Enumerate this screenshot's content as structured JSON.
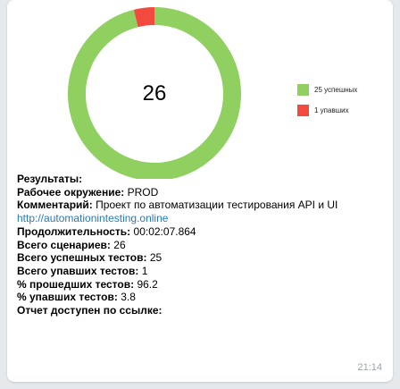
{
  "message": {
    "chart_data": {
      "type": "donut",
      "center_text": "26",
      "values": [
        25,
        1
      ],
      "labels": [
        "25 успешных",
        "1 упавших"
      ],
      "colors": [
        "#90d060",
        "#f24a3e"
      ]
    },
    "legend": [
      {
        "label": "25 успешных",
        "color": "#90d060"
      },
      {
        "label": "1 упавших",
        "color": "#f24a3e"
      }
    ],
    "report": {
      "results_label": "Результаты:",
      "env_label": "Рабочее окружение:",
      "env_value": "PROD",
      "comment_label": "Комментарий:",
      "comment_value": "Проект по автоматизации тестирования API и UI",
      "link": "http://automationintesting.online",
      "duration_label": "Продолжительность:",
      "duration_value": "00:02:07.864",
      "total_label": "Всего сценариев:",
      "total_value": "26",
      "passed_label": "Всего успешных тестов:",
      "passed_value": "25",
      "failed_label": "Всего упавших тестов:",
      "failed_value": "1",
      "passed_pct_label": "% прошедших тестов:",
      "passed_pct_value": "96.2",
      "failed_pct_label": "% упавших тестов:",
      "failed_pct_value": "3.8",
      "report_label": "Отчет доступен по ссылке:"
    },
    "time": "21:14"
  }
}
